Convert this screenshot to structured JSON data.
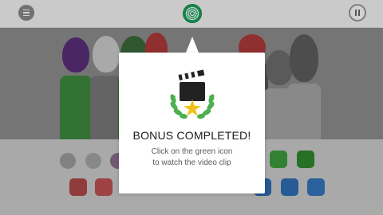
{
  "topbar": {
    "menu_icon": "hamburger-icon",
    "bonus_icon": "green-spiral-icon",
    "pause_icon": "pause-icon"
  },
  "popup": {
    "icon": "clapperboard-trophy-icon",
    "title": "BONUS COMPLETED!",
    "line1": "Click on the green icon",
    "line2": "to watch the video clip"
  },
  "colors": {
    "bonus_green": "#19a860",
    "stage_gray": "#8f8f8f",
    "tray_gray": "#cfcfcf",
    "laurel_green": "#4caf50",
    "star_yellow": "#f2c21b"
  }
}
